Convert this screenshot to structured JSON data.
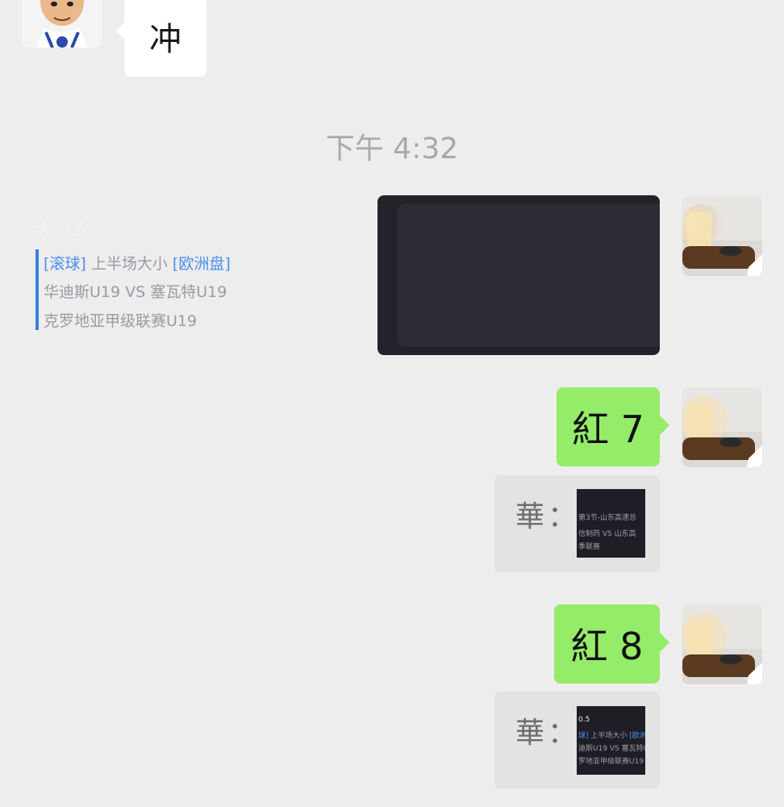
{
  "messages": {
    "incoming_1": {
      "text": "冲"
    },
    "time_label": "下午 4:32",
    "card": {
      "title": "大 0.5",
      "tag1": "[滚球]",
      "market": " 上半场大小 ",
      "tag2": "[欧洲盘]",
      "match": "华迪斯U19 VS 塞瓦特U19",
      "league": "克罗地亚甲级联赛U19"
    },
    "out_msg_1": {
      "text": "紅 7",
      "quote_sender": "華：",
      "quote_thumb": {
        "line1": "第3节-山东高速总",
        "line2": "信制药  VS  山东高",
        "line3": "季联赛"
      }
    },
    "out_msg_2": {
      "text": "紅 8",
      "quote_sender": "華：",
      "quote_thumb": {
        "line1": "0.5",
        "line2_tag": "球]",
        "line2_market": " 上半场大小 ",
        "line2_tag2": "[欧洲",
        "line3": "迪斯U19 VS 塞瓦特U1",
        "line4": "罗地亚甲级联赛U19"
      }
    }
  },
  "colors": {
    "background": "#ededed",
    "green_bubble": "#95ec69",
    "card_bg": "#22232a",
    "accent_blue": "#4a8df0"
  },
  "icons": {
    "incoming_avatar": "cartoon-man-avatar",
    "my_avatar": "candle-lamp-avatar"
  }
}
